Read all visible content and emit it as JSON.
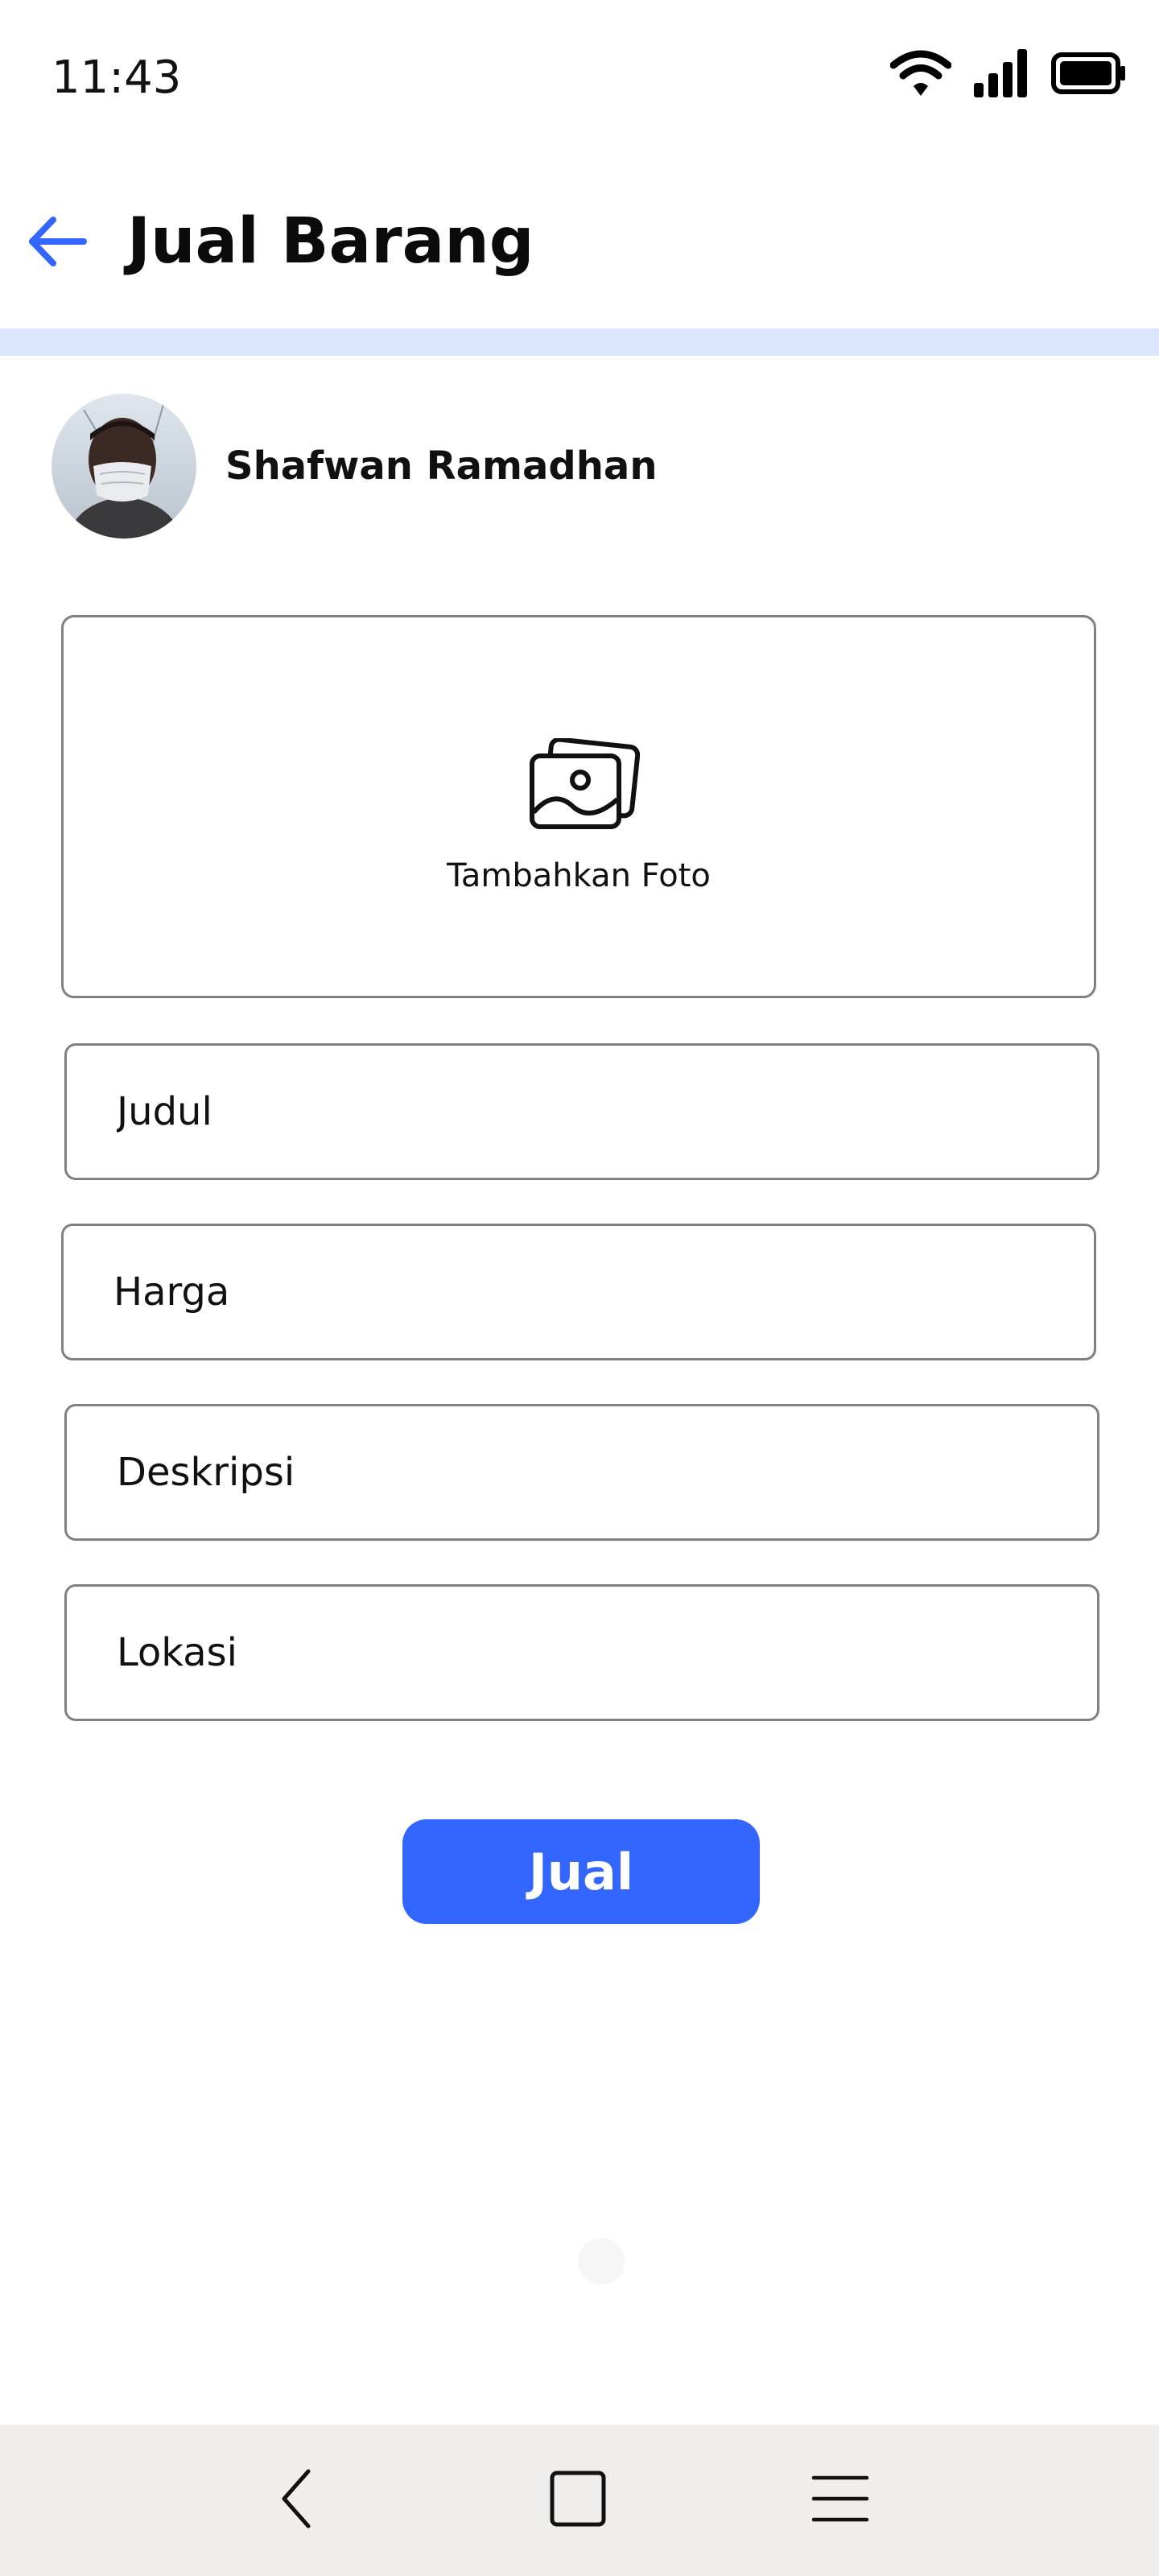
{
  "status_bar": {
    "time": "11:43",
    "icons": [
      "wifi-icon",
      "signal-icon",
      "battery-icon"
    ]
  },
  "header": {
    "back_icon": "arrow-left-icon",
    "title": "Jual Barang"
  },
  "user": {
    "name": "Shafwan Ramadhan",
    "avatar": "avatar-photo"
  },
  "photo_upload": {
    "icon": "photo-gallery-icon",
    "label": "Tambahkan Foto"
  },
  "form": {
    "judul_placeholder": "Judul",
    "harga_placeholder": "Harga",
    "deskripsi_placeholder": "Deskripsi",
    "lokasi_placeholder": "Lokasi"
  },
  "submit": {
    "label": "Jual"
  },
  "system_nav": {
    "items": [
      "back-chevron-icon",
      "home-square-icon",
      "menu-lines-icon"
    ]
  },
  "colors": {
    "accent": "#3366ff",
    "divider": "#dbe5fd",
    "nav_background": "#efeeed",
    "border": "#808080"
  }
}
